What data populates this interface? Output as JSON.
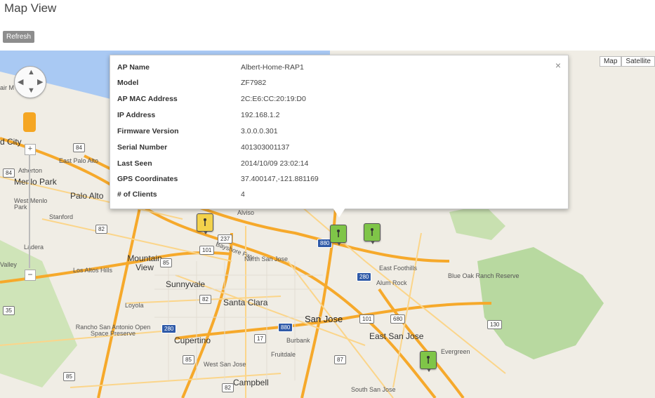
{
  "page": {
    "title": "Map View",
    "refresh_label": "Refresh"
  },
  "map": {
    "map_type_map": "Map",
    "map_type_satellite": "Satellite",
    "zoom_plus": "+",
    "zoom_minus": "−",
    "labels": {
      "red_city": "d City",
      "atherton": "Atherton",
      "menlo_park": "Menlo Park",
      "east_palo_alto": "East Palo Alto",
      "palo_alto": "Palo Alto",
      "west_menlo_park": "West Menlo Park",
      "stanford": "Stanford",
      "ladera": "Ladera",
      "valley": "Valley",
      "los_altos_hills": "Los Altos Hills",
      "mountain_view": "Mountain View",
      "sunnyvale": "Sunnyvale",
      "santa_clara": "Santa Clara",
      "north_san_jose": "North San Jose",
      "san_jose": "San Jose",
      "east_san_jose": "East San Jose",
      "east_foothills": "East Foothills",
      "alum_rock": "Alum Rock",
      "blue_oak": "Blue Oak Ranch Reserve",
      "rancho": "Rancho San Antonio Open Space Preserve",
      "cupertino": "Cupertino",
      "burbank": "Burbank",
      "fruitdale": "Fruitdale",
      "west_san_jose": "West San Jose",
      "campbell": "Campbell",
      "south_san_jose": "South San Jose",
      "evergreen": "Evergreen",
      "loyola": "Loyola",
      "alviso": "Alviso",
      "bayshore": "Bayshore Fwy",
      "air": "air M"
    },
    "highways": [
      "84",
      "84",
      "101",
      "82",
      "237",
      "880",
      "101",
      "85",
      "280",
      "82",
      "87",
      "880",
      "130",
      "280",
      "17",
      "101",
      "680",
      "85",
      "35",
      "85",
      "82"
    ]
  },
  "info": {
    "close": "×",
    "rows": [
      {
        "label": "AP Name",
        "value": "Albert-Home-RAP1"
      },
      {
        "label": "Model",
        "value": "ZF7982"
      },
      {
        "label": "AP MAC Address",
        "value": "2C:E6:CC:20:19:D0"
      },
      {
        "label": "IP Address",
        "value": "192.168.1.2"
      },
      {
        "label": "Firmware Version",
        "value": "3.0.0.0.301"
      },
      {
        "label": "Serial Number",
        "value": "401303001137"
      },
      {
        "label": "Last Seen",
        "value": "2014/10/09 23:02:14"
      },
      {
        "label": "GPS Coordinates",
        "value": "37.400147,-121.881169"
      },
      {
        "label": "# of Clients",
        "value": "4"
      }
    ]
  },
  "colors": {
    "freeway": "#f6a92b",
    "road": "#fbd58a",
    "park": "#b8d9a0",
    "water": "#a9c9f3",
    "land": "#f0ede5"
  },
  "icons": {
    "pan": "pan-control-icon",
    "pegman": "pegman-icon",
    "ap": "access-point-icon"
  }
}
